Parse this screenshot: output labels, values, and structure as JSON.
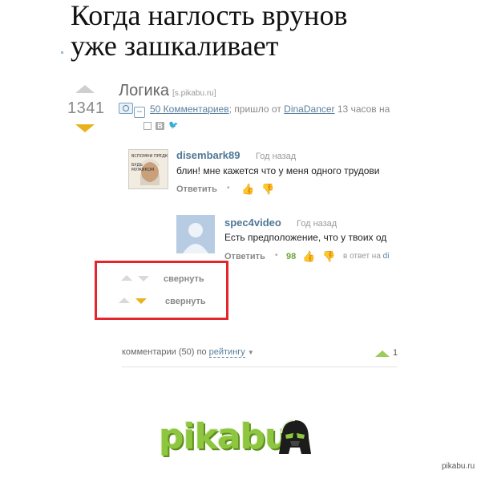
{
  "meme": {
    "title_line1": "Когда наглость врунов",
    "title_line2": "уже зашкаливает"
  },
  "post": {
    "rating": "1341",
    "title": "Логика",
    "domain": "[s.pikabu.ru]",
    "minus": "–",
    "comments_link": "50 Комментариев",
    "meta_mid": "; пришло от ",
    "author": "DinaDancer",
    "time_ago": " 13 часов на",
    "vk": "В",
    "twitter": "🐦"
  },
  "comments": [
    {
      "username": "disembark89",
      "time": "Год назад",
      "text": "блин! мне кажется что у меня одного трудови",
      "reply_label": "Ответить",
      "avatar_text": "ВСПОМНИ ПРЕДКОВ\nБУДЬ МУЖИКОМ"
    },
    {
      "username": "spec4video",
      "time": "Год назад",
      "text": "Есть предположение, что у твоих од",
      "reply_label": "Ответить",
      "score": "98",
      "reply_to_prefix": "в ответ на ",
      "reply_to_user": "di"
    }
  ],
  "collapse": {
    "label1": "свернуть",
    "label2": "свернуть"
  },
  "footer": {
    "count_text": "комментарии (50) по ",
    "sort_label": "рейтингу",
    "caret": "▼",
    "right_count": "1"
  },
  "logo": {
    "text": "pikabu"
  },
  "watermark": "pikabu.ru",
  "colors": {
    "highlight": "#e3262b",
    "downvote_active": "#e8b21e",
    "link": "#5a7f9e",
    "logo_green": "#8ec63f"
  }
}
